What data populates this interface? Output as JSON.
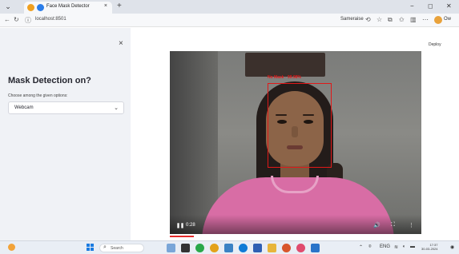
{
  "browser": {
    "tab_title": "Face Mask Detector",
    "tab_close": "×",
    "new_tab": "+",
    "win_min": "−",
    "win_max": "◻",
    "win_close": "✕",
    "url": "localhost:8501",
    "profile_name": "Sameraise",
    "profile_short": "Ow"
  },
  "sidebar": {
    "close": "×",
    "title": "Mask Detection on?",
    "label": "Choose among the given options:",
    "select_value": "Webcam",
    "caret": "⌄"
  },
  "main": {
    "deploy": "Deploy",
    "detection_label": "No Mask · 99.98%",
    "time": "0:28",
    "play": "❚❚"
  },
  "taskbar": {
    "search_placeholder": "Search",
    "tray_lang": "ENG",
    "clock_time": "17:37",
    "clock_date": "30-03-2024"
  }
}
